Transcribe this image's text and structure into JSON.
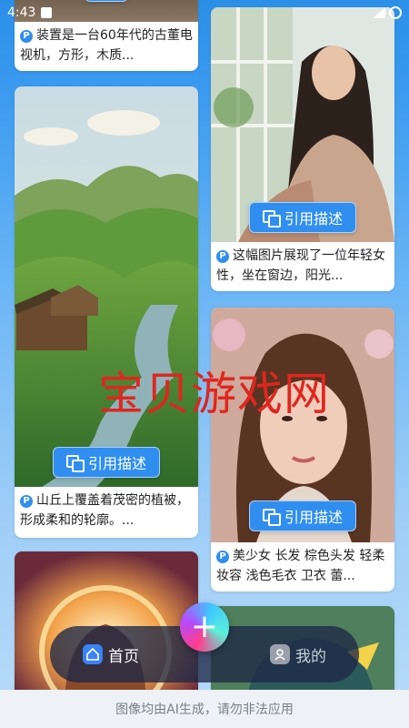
{
  "status": {
    "time": "4:43"
  },
  "cards": {
    "tv": {
      "caption": "装置是一台60年代的古董电视机，方形，木质..."
    },
    "hills": {
      "cite_label": "引用描述",
      "caption": "山丘上覆盖着茂密的植被，形成柔和的轮廓。..."
    },
    "window_girl": {
      "cite_label": "引用描述",
      "caption": "这幅图片展现了一位年轻女性，坐在窗边，阳光..."
    },
    "portrait": {
      "cite_label": "引用描述",
      "caption": "美少女 长发 棕色头发 轻柔妆容 浅色毛衣 卫衣 蕾..."
    }
  },
  "watermark": "宝贝游戏网",
  "nav": {
    "home_label": "首页",
    "mine_label": "我的",
    "fab_symbol": "+"
  },
  "footer": {
    "notice": "图像均由AI生成，请勿非法应用"
  },
  "colors": {
    "accent": "#2f8ef0",
    "watermark": "#e0261f"
  }
}
